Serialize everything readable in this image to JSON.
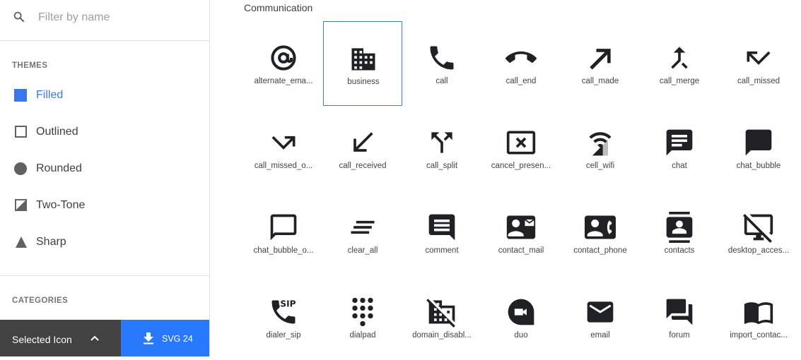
{
  "search": {
    "placeholder": "Filter by name"
  },
  "themes": {
    "title": "THEMES",
    "items": [
      "Filled",
      "Outlined",
      "Rounded",
      "Two-Tone",
      "Sharp"
    ]
  },
  "categories": {
    "title": "CATEGORIES"
  },
  "bottom": {
    "selected_label": "Selected Icon",
    "download_label": "SVG 24"
  },
  "colors": {
    "accent": "#3b78e7",
    "download_bg": "#2979ff",
    "dark_bar": "#424242",
    "icon": "#202124"
  },
  "group": {
    "title": "Communication",
    "selected_index": 1,
    "icons": [
      "alternate_ema...",
      "business",
      "call",
      "call_end",
      "call_made",
      "call_merge",
      "call_missed",
      "call_missed_o...",
      "call_received",
      "call_split",
      "cancel_presen...",
      "cell_wifi",
      "chat",
      "chat_bubble",
      "chat_bubble_o...",
      "clear_all",
      "comment",
      "contact_mail",
      "contact_phone",
      "contacts",
      "desktop_acces...",
      "dialer_sip",
      "dialpad",
      "domain_disabl...",
      "duo",
      "email",
      "forum",
      "import_contac..."
    ]
  }
}
